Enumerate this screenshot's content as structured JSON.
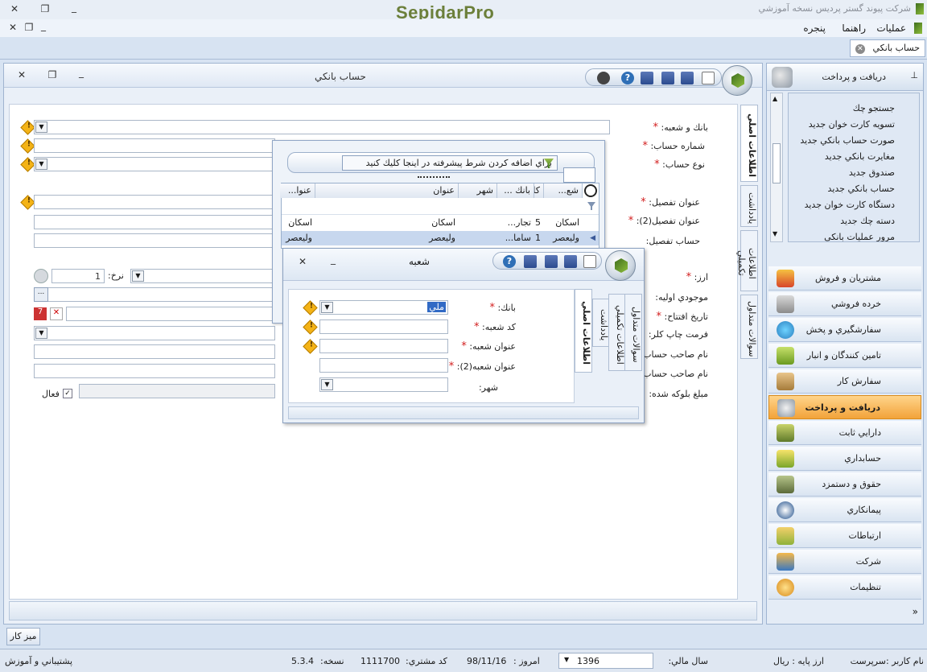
{
  "app": {
    "title": "شرکت پيوند گستر پرديس نسخه آموزشي",
    "logo": "SepidarPro",
    "menu": [
      "عمليات",
      "راهنما",
      "پنجره"
    ]
  },
  "doc_tab": {
    "label": "حساب بانكي"
  },
  "form": {
    "title": "حساب بانكي",
    "labels": {
      "bank_branch": "بانك و شعبه:",
      "account_no": "شماره حساب:",
      "account_type": "نوع حساب:",
      "detail_title": "عنوان تفصيل:",
      "detail_title2": "عنوان تفصيل(2):",
      "detail_account": "حساب تفصيل:",
      "currency": "ارز:",
      "initial_balance": "موجودي اوليه:",
      "open_date": "تاريخ افتتاح:",
      "check_format": "فرمت چاپ كلر:",
      "owner_name": "نام صاحب حساب:",
      "owner_name2": "نام صاحب حساب (2)",
      "blocked_amount": "مبلغ بلوکه شده:",
      "rate": "نرخ:",
      "active": "فعال"
    },
    "rate_value": "1",
    "tabs": [
      "اطلاعات اصلي",
      "يادداشت",
      "اطلاعات تكميلي",
      "سوالات متداول"
    ]
  },
  "lookup": {
    "filter_hint": "براي اضافه كردن شرط پيشرفته در اينجا كليك كنيد",
    "columns": [
      "شع...",
      "كا",
      "بانك ...",
      "شهر",
      "عنوان",
      "عنوا..."
    ],
    "rows": [
      [
        "اسكان",
        "5",
        "تجار...",
        "",
        "اسكان",
        "اسكان"
      ],
      [
        "وليعصر",
        "1",
        "ساما...",
        "",
        "وليعصر",
        "وليعصر"
      ]
    ]
  },
  "branch": {
    "title": "شعبه",
    "labels": {
      "bank": "بانك:",
      "code": "كد شعبه:",
      "title": "عنوان شعبه:",
      "title2": "عنوان شعبه(2):",
      "city": "شهر:"
    },
    "bank_value": "ملي",
    "tabs": [
      "اطلاعات اصلي",
      "يادداشت",
      "اطلاعات تكميلي",
      "سوالات متداول"
    ]
  },
  "nav": {
    "header": "دريافت و پرداخت",
    "links": [
      "جستجو چك",
      "تسويه كارت خوان جديد",
      "صورت حساب بانكي جديد",
      "مغايرت بانكي جديد",
      "صندوق جديد",
      "حساب بانكي جديد",
      "دستگاه كارت خوان جديد",
      "دسته چك جديد",
      "مرور عمليات بانكي"
    ],
    "categories": [
      "مشتريان و فروش",
      "خرده فروشي",
      "سفارشگيري و پخش",
      "تامين كنندگان و انبار",
      "سفارش كار",
      "دريافت و پرداخت",
      "دارايي ثابت",
      "حسابداري",
      "حقوق و دستمزد",
      "پيمانكاري",
      "ارتباطات",
      "شركت",
      "تنظيمات"
    ],
    "active_category": "دريافت و پرداخت"
  },
  "desk": {
    "label": "ميز كار"
  },
  "status": {
    "user_label": "نام كاربر :",
    "user": "سرپرست",
    "base_currency_label": "ارز پايه :",
    "base_currency": "ريال",
    "fiscal_year_label": "سال مالي:",
    "fiscal_year": "1396",
    "today_label": "امروز :",
    "today": "98/11/16",
    "customer_code_label": "كد مشتري:",
    "customer_code": "1111700",
    "version_label": "نسخه:",
    "version": "5.3.4",
    "support": "پشتيباني و آموزش"
  },
  "colors": {
    "accent": "#f2a33a",
    "required": "#d21d1d",
    "logo_green": "#6b7f3a"
  }
}
